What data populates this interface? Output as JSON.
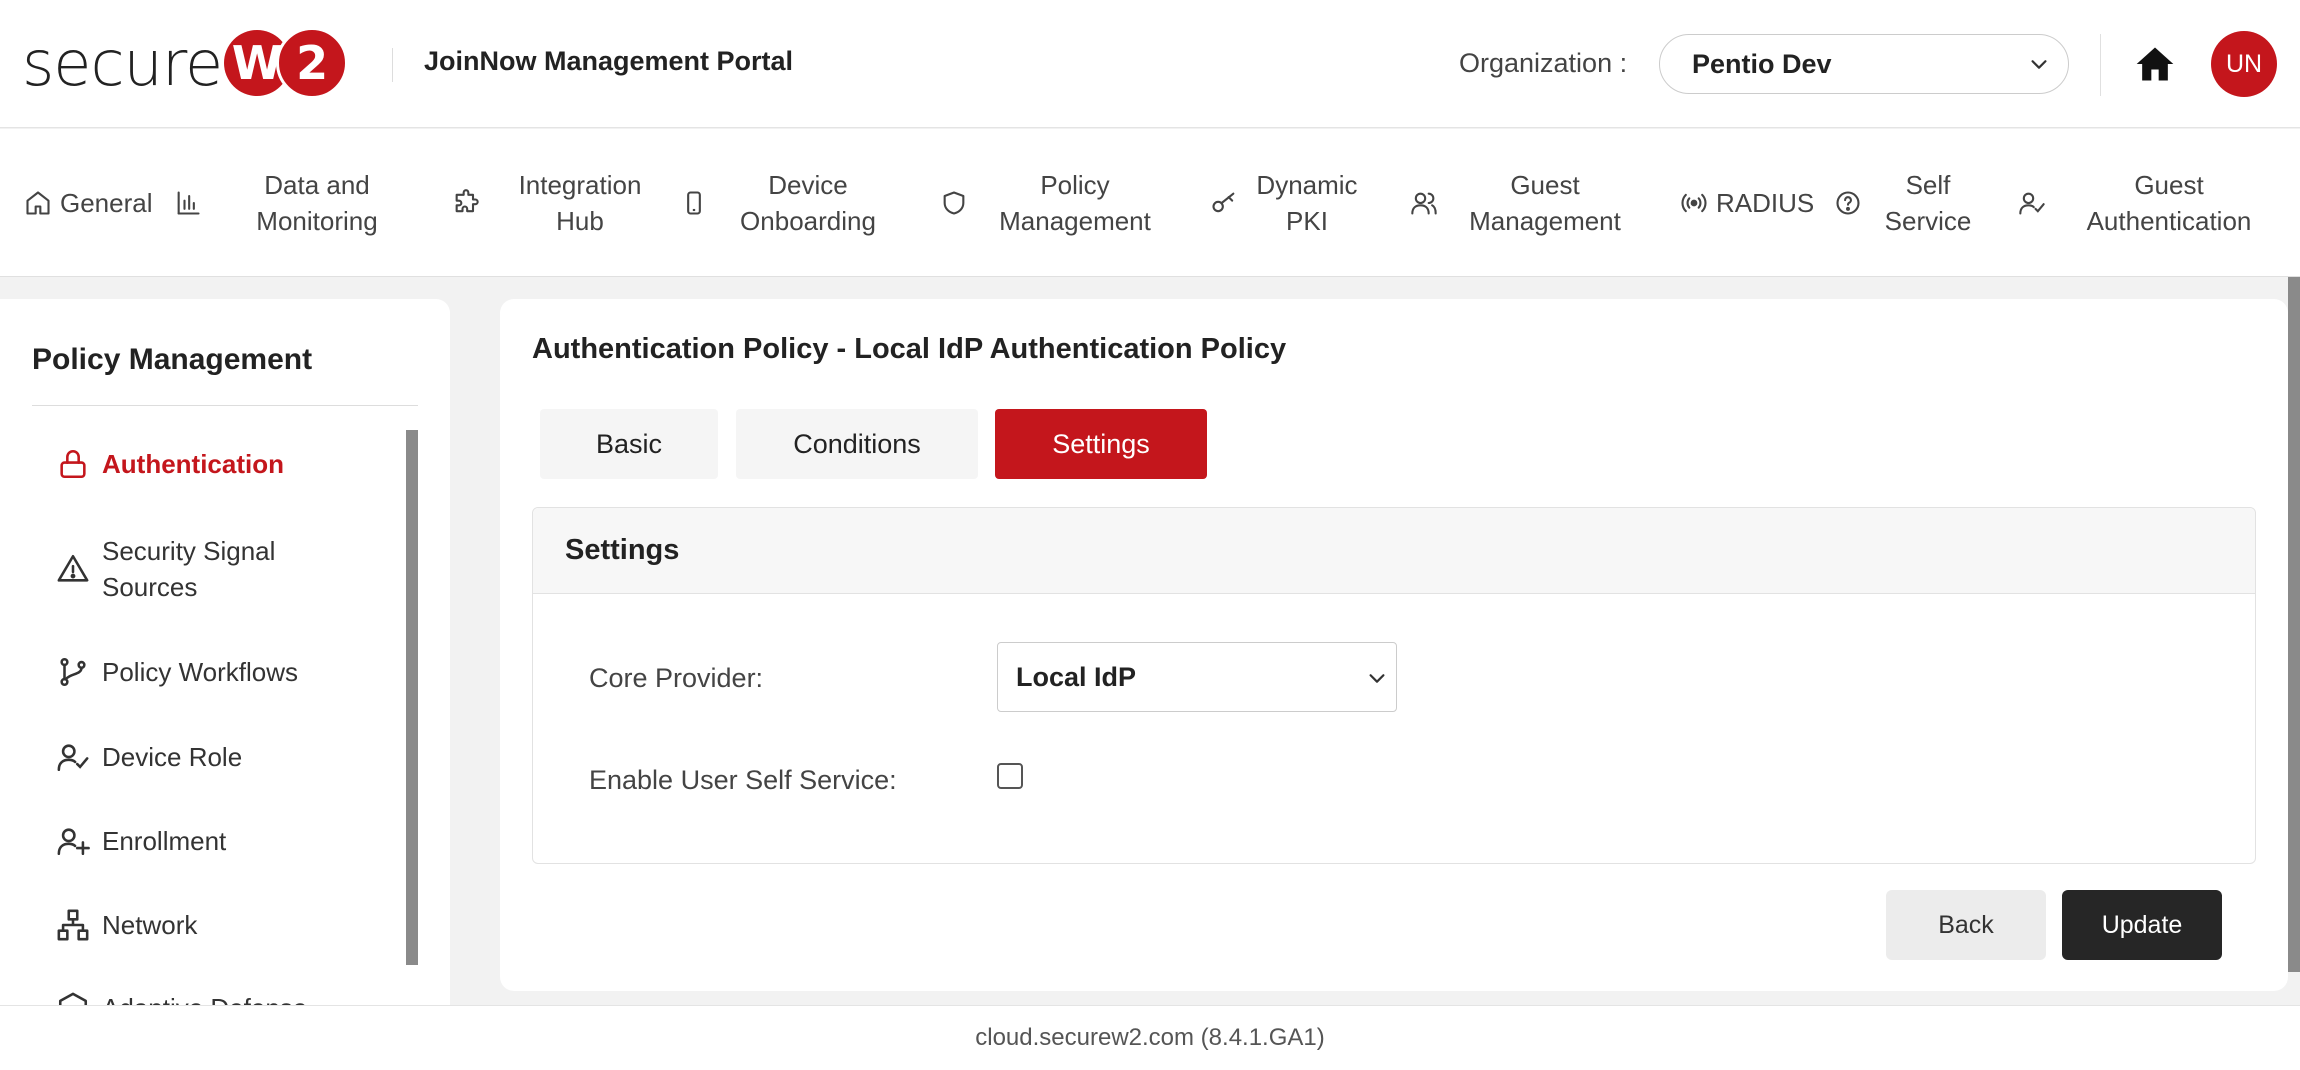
{
  "header": {
    "logo_text": "secure",
    "logo_w": "W",
    "logo_2": "2",
    "portal_title": "JoinNow Management Portal",
    "org_label": "Organization :",
    "org_value": "Pentio Dev",
    "avatar_initials": "UN"
  },
  "topnav": {
    "items": [
      {
        "label": "General",
        "icon": "home-outline-icon"
      },
      {
        "label": "Data and Monitoring",
        "icon": "bar-chart-icon"
      },
      {
        "label": "Integration Hub",
        "icon": "puzzle-icon"
      },
      {
        "label": "Device Onboarding",
        "icon": "phone-icon"
      },
      {
        "label": "Policy Management",
        "icon": "shield-icon"
      },
      {
        "label": "Dynamic PKI",
        "icon": "key-icon"
      },
      {
        "label": "Guest Management",
        "icon": "users-icon"
      },
      {
        "label": "RADIUS",
        "icon": "radio-waves-icon"
      },
      {
        "label": "Self Service",
        "icon": "help-circle-icon"
      },
      {
        "label": "Guest Authentication",
        "icon": "user-check-icon"
      }
    ]
  },
  "sidebar": {
    "title": "Policy Management",
    "items": [
      {
        "label": "Authentication",
        "icon": "lock-icon",
        "active": true
      },
      {
        "label": "Security Signal Sources",
        "icon": "warning-icon"
      },
      {
        "label": "Policy Workflows",
        "icon": "workflow-icon"
      },
      {
        "label": "Device Role",
        "icon": "user-check-icon"
      },
      {
        "label": "Enrollment",
        "icon": "user-plus-icon"
      },
      {
        "label": "Network",
        "icon": "network-icon"
      },
      {
        "label": "Adaptive Defense",
        "icon": "hexagon-icon"
      }
    ]
  },
  "main": {
    "title": "Authentication Policy - Local IdP Authentication Policy",
    "tabs": [
      {
        "label": "Basic"
      },
      {
        "label": "Conditions"
      },
      {
        "label": "Settings",
        "active": true
      }
    ],
    "card": {
      "title": "Settings",
      "core_provider_label": "Core Provider:",
      "core_provider_value": "Local IdP",
      "self_service_label": "Enable User Self Service:",
      "self_service_checked": false
    },
    "back_label": "Back",
    "update_label": "Update"
  },
  "footer": {
    "text": "cloud.securew2.com (8.4.1.GA1)"
  },
  "colors": {
    "brand": "#c4161c",
    "dark_button": "#262626"
  }
}
